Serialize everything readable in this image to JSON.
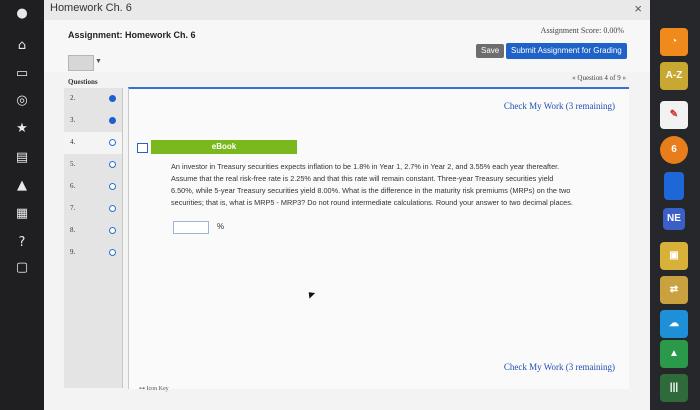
{
  "browser": {
    "tab_title": "Homework Ch. 6",
    "close_symbol": "×"
  },
  "left_rail": {
    "icons": [
      "pin-icon",
      "home-icon",
      "laptop-icon",
      "compass-icon",
      "star-icon",
      "book-icon",
      "graduation-cap-icon",
      "calendar-icon",
      "help-icon",
      "chat-icon"
    ]
  },
  "header": {
    "assignment_title": "Assignment: Homework Ch. 6",
    "score_label": "Assignment Score: 0.00%",
    "save_label": "Save",
    "submit_label": "Submit Assignment for Grading"
  },
  "questions": {
    "header": "Questions",
    "nav_label": "« Question 4 of 9 »",
    "items": [
      {
        "num": "2.",
        "status": "filled"
      },
      {
        "num": "3.",
        "status": "filled"
      },
      {
        "num": "4.",
        "status": "empty"
      },
      {
        "num": "5.",
        "status": "empty"
      },
      {
        "num": "6.",
        "status": "empty"
      },
      {
        "num": "7.",
        "status": "empty"
      },
      {
        "num": "8.",
        "status": "empty"
      },
      {
        "num": "9.",
        "status": "empty"
      }
    ]
  },
  "problem": {
    "check_top": "Check My Work (3 remaining)",
    "check_bottom": "Check My Work (3 remaining)",
    "ebook_label": "eBook",
    "line1": "An investor in Treasury securities expects inflation to be 1.8% in Year 1, 2.7% in Year 2, and 3.55% each year thereafter.",
    "line2": "Assume that the real risk-free rate is 2.25% and that this rate will remain constant. Three-year Treasury securities yield",
    "line3": "6.50%, while 5-year Treasury securities yield 8.00%. What is the difference in the maturity risk premiums (MRPs) on the two",
    "line4": "securities; that is, what is MRP5 - MRP3? Do not round intermediate calculations. Round your answer to two decimal places.",
    "answer_value": "",
    "unit": "%",
    "hint": "Icon Key"
  },
  "right_rail": {
    "apps": [
      {
        "name": "rss-icon",
        "label": "RSS",
        "color": "#f08a1c"
      },
      {
        "name": "dictionary-icon",
        "label": "A-Z",
        "color": "#c8a832"
      },
      {
        "name": "notes-icon",
        "label": "✎",
        "color": "#f2f2f2"
      },
      {
        "name": "sync-icon",
        "label": "6",
        "color": "#e87d1b"
      },
      {
        "name": "panel-icon",
        "label": "",
        "color": "#1e67d8"
      },
      {
        "name": "ne-icon",
        "label": "NE",
        "color": "#3a5fc7"
      },
      {
        "name": "image-icon",
        "label": "",
        "color": "#d8b13a"
      },
      {
        "name": "shuffle-icon",
        "label": "⇄",
        "color": "#c9a13e"
      },
      {
        "name": "cloud-icon",
        "label": "☁",
        "color": "#1e90d8"
      },
      {
        "name": "drive-icon",
        "label": "▲",
        "color": "#2a9a4a"
      },
      {
        "name": "barcode-icon",
        "label": "|||",
        "color": "#2f6b3a"
      }
    ]
  }
}
